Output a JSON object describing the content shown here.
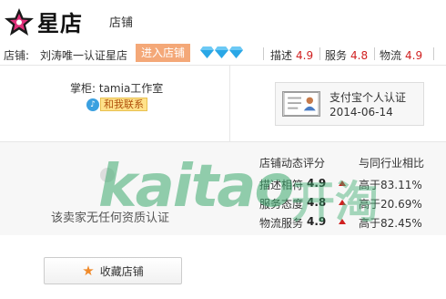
{
  "header": {
    "logo_text": "星店",
    "shop_link": "店铺"
  },
  "infobar": {
    "shop_label": "店铺:",
    "shop_name": "刘涛唯一认证星店",
    "enter_button": "进入店铺",
    "scores": [
      {
        "label": "描述",
        "value": "4.9"
      },
      {
        "label": "服务",
        "value": "4.8"
      },
      {
        "label": "物流",
        "value": "4.9"
      }
    ]
  },
  "seller": {
    "keeper": "掌柜: tamia工作室",
    "contact": "和我联系",
    "contact_icon_glyph": "♪"
  },
  "certification": {
    "title": "支付宝个人认证",
    "date": "2014-06-14"
  },
  "ratings": {
    "heading": "店铺动态评分",
    "compare_heading": "与同行业相比",
    "rows": [
      {
        "label": "描述相符",
        "value": "4.9",
        "compare": "高于83.11%"
      },
      {
        "label": "服务态度",
        "value": "4.8",
        "compare": "高于20.69%"
      },
      {
        "label": "物流服务",
        "value": "4.9",
        "compare": "高于82.45%"
      }
    ]
  },
  "qualification": "该卖家无任何资质认证",
  "favorite_button": "收藏店铺",
  "watermark": {
    "latin": "kaitao",
    "cn": "开淘"
  },
  "colors": {
    "accent_orange": "#f4a878",
    "score_red": "#d02020",
    "diamond_blue": "#2aa7e6",
    "watermark_green": "#3caa6e"
  }
}
